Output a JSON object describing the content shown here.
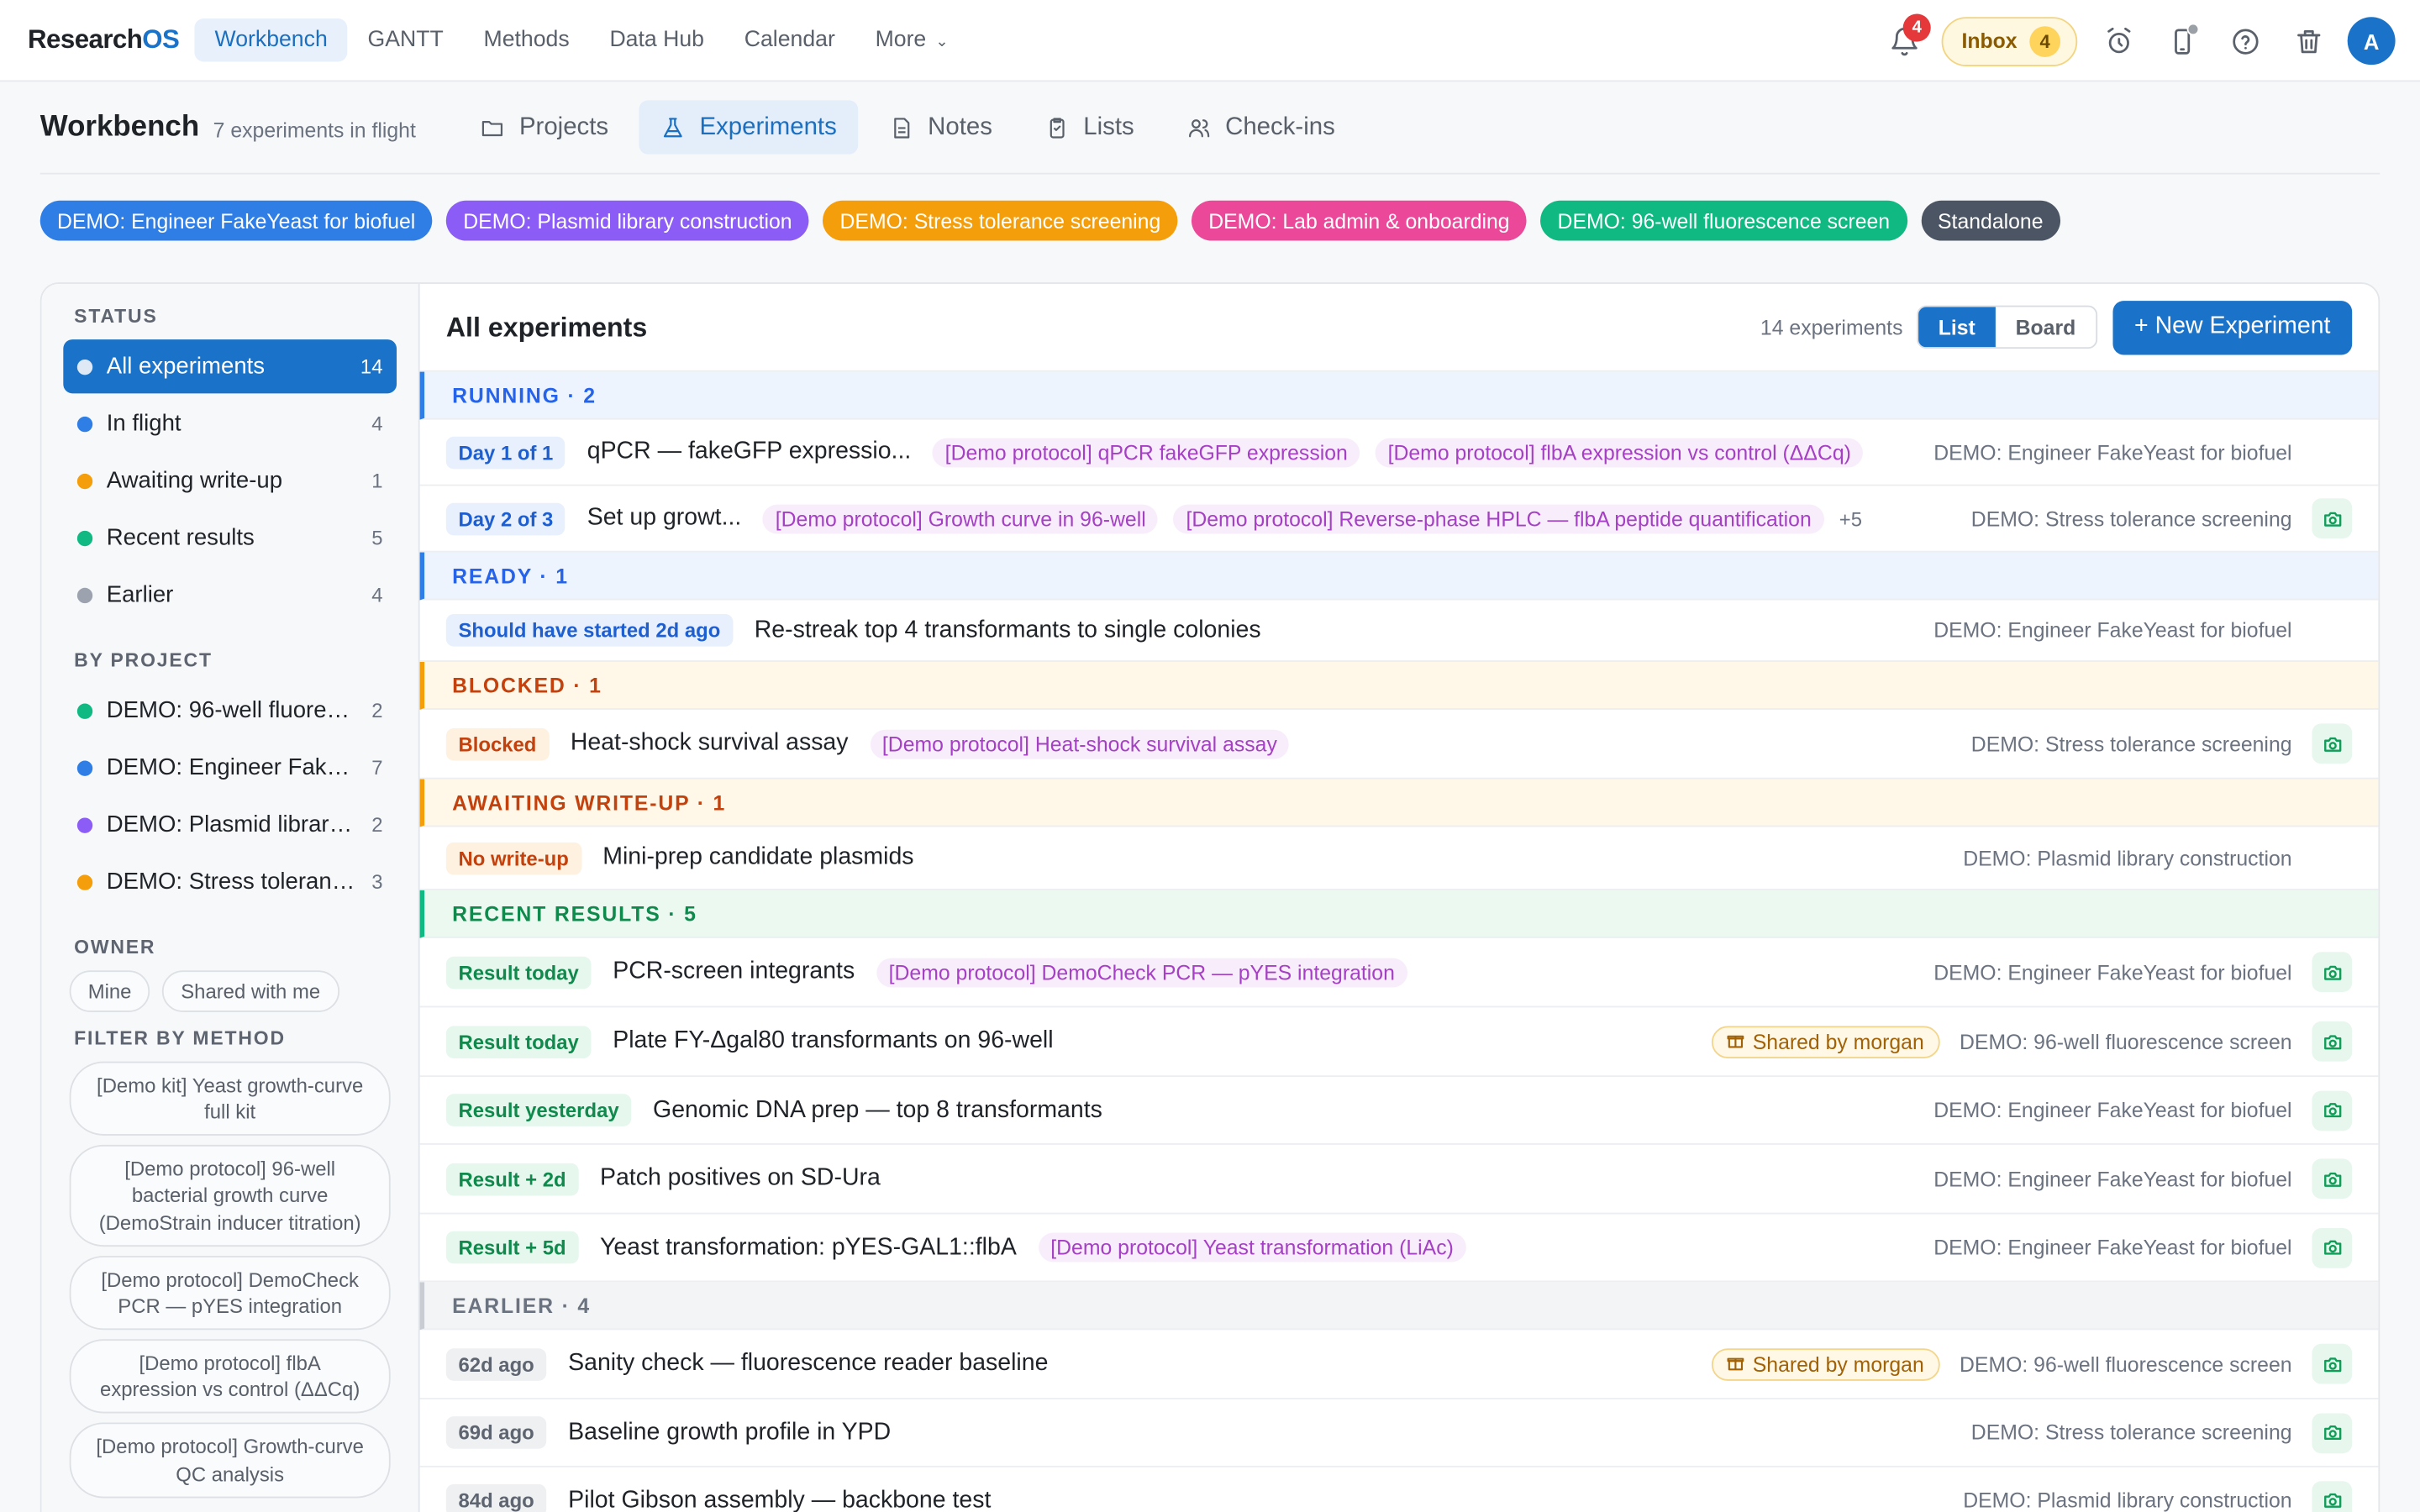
{
  "brand": {
    "name": "Research",
    "accent": "OS"
  },
  "nav": {
    "links": [
      "Workbench",
      "GANTT",
      "Methods",
      "Data Hub",
      "Calendar",
      "More"
    ],
    "notifications_count": "4",
    "inbox_label": "Inbox",
    "inbox_count": "4",
    "avatar_initial": "A"
  },
  "page": {
    "title": "Workbench",
    "subtitle": "7 experiments in flight",
    "tabs": [
      "Projects",
      "Experiments",
      "Notes",
      "Lists",
      "Check-ins"
    ]
  },
  "project_chips": [
    {
      "label": "DEMO: Engineer FakeYeast for biofuel",
      "color": "#2f7ee6"
    },
    {
      "label": "DEMO: Plasmid library construction",
      "color": "#8b5cf6"
    },
    {
      "label": "DEMO: Stress tolerance screening",
      "color": "#f59e0b"
    },
    {
      "label": "DEMO: Lab admin & onboarding",
      "color": "#ec4899"
    },
    {
      "label": "DEMO: 96-well fluorescence screen",
      "color": "#10b981"
    },
    {
      "label": "Standalone",
      "color": "#4b5563"
    }
  ],
  "sidebar": {
    "status_heading": "STATUS",
    "status": [
      {
        "label": "All experiments",
        "count": "14",
        "color": "#dfe9f5"
      },
      {
        "label": "In flight",
        "count": "4",
        "color": "#2f7ee6"
      },
      {
        "label": "Awaiting write-up",
        "count": "1",
        "color": "#f59e0b"
      },
      {
        "label": "Recent results",
        "count": "5",
        "color": "#10b981"
      },
      {
        "label": "Earlier",
        "count": "4",
        "color": "#9ca3af"
      }
    ],
    "project_heading": "BY PROJECT",
    "projects": [
      {
        "label": "DEMO: 96-well fluorescence screen",
        "count": "2",
        "color": "#10b981"
      },
      {
        "label": "DEMO: Engineer FakeYeast for biofuel",
        "count": "7",
        "color": "#2f7ee6"
      },
      {
        "label": "DEMO: Plasmid library construction",
        "count": "2",
        "color": "#8b5cf6"
      },
      {
        "label": "DEMO: Stress tolerance screening",
        "count": "3",
        "color": "#f59e0b"
      }
    ],
    "owner_heading": "OWNER",
    "owner": [
      "Mine",
      "Shared with me"
    ],
    "method_heading": "FILTER BY METHOD",
    "methods": [
      "[Demo kit] Yeast growth-curve full kit",
      "[Demo protocol] 96-well bacterial growth curve (DemoStrain inducer titration)",
      "[Demo protocol] DemoCheck PCR — pYES integration",
      "[Demo protocol] flbA expression vs control (ΔΔCq)",
      "[Demo protocol] Growth-curve QC analysis"
    ]
  },
  "content": {
    "title": "All experiments",
    "count_label": "14 experiments",
    "view_list": "List",
    "view_board": "Board",
    "new_button": "+ New Experiment"
  },
  "groups": [
    {
      "label": "RUNNING · 2",
      "color": "#2563eb",
      "bg": "#eef4fd",
      "border": "#2f7ee6"
    },
    {
      "label": "READY · 1",
      "color": "#2563eb",
      "bg": "#eef4fd",
      "border": "#2f7ee6"
    },
    {
      "label": "BLOCKED · 1",
      "color": "#c2410c",
      "bg": "#fff8e8",
      "border": "#f59e0b"
    },
    {
      "label": "AWAITING WRITE-UP · 1",
      "color": "#c2410c",
      "bg": "#fff8e8",
      "border": "#f59e0b"
    },
    {
      "label": "RECENT RESULTS · 5",
      "color": "#0f8a4c",
      "bg": "#ebf9f1",
      "border": "#10b981"
    },
    {
      "label": "EARLIER · 4",
      "color": "#6b7280",
      "bg": "#f3f4f6",
      "border": "#c9cdd3"
    }
  ],
  "rows": [
    {
      "tag": "Day 1 of 1",
      "title": "qPCR — fakeGFP expressio...",
      "protocols": [
        "[Demo protocol] qPCR fakeGFP expression",
        "[Demo protocol] flbA expression vs control (ΔΔCq)"
      ],
      "more": "",
      "shared": "",
      "project": "DEMO: Engineer FakeYeast for biofuel",
      "camera": false
    },
    {
      "tag": "Day 2 of 3",
      "title": "Set up growt...",
      "protocols": [
        "[Demo protocol] Growth curve in 96-well",
        "[Demo protocol] Reverse-phase HPLC — flbA peptide quantification"
      ],
      "more": "+5",
      "shared": "",
      "project": "DEMO: Stress tolerance screening",
      "camera": true
    },
    {
      "tag": "Should have started 2d ago",
      "title": "Re-streak top 4 transformants to single colonies",
      "protocols": [],
      "more": "",
      "shared": "",
      "project": "DEMO: Engineer FakeYeast for biofuel",
      "camera": false
    },
    {
      "tag": "Blocked",
      "title": "Heat-shock survival assay",
      "protocols": [
        "[Demo protocol] Heat-shock survival assay"
      ],
      "more": "",
      "shared": "",
      "project": "DEMO: Stress tolerance screening",
      "camera": true
    },
    {
      "tag": "No write-up",
      "title": "Mini-prep candidate plasmids",
      "protocols": [],
      "more": "",
      "shared": "",
      "project": "DEMO: Plasmid library construction",
      "camera": false
    },
    {
      "tag": "Result today",
      "title": "PCR-screen integrants",
      "protocols": [
        "[Demo protocol] DemoCheck PCR — pYES integration"
      ],
      "more": "",
      "shared": "",
      "project": "DEMO: Engineer FakeYeast for biofuel",
      "camera": true
    },
    {
      "tag": "Result today",
      "title": "Plate FY-Δgal80 transformants on 96-well",
      "protocols": [],
      "more": "",
      "shared": "Shared by morgan",
      "project": "DEMO: 96-well fluorescence screen",
      "camera": true
    },
    {
      "tag": "Result yesterday",
      "title": "Genomic DNA prep — top 8 transformants",
      "protocols": [],
      "more": "",
      "shared": "",
      "project": "DEMO: Engineer FakeYeast for biofuel",
      "camera": true
    },
    {
      "tag": "Result + 2d",
      "title": "Patch positives on SD-Ura",
      "protocols": [],
      "more": "",
      "shared": "",
      "project": "DEMO: Engineer FakeYeast for biofuel",
      "camera": true
    },
    {
      "tag": "Result + 5d",
      "title": "Yeast transformation: pYES-GAL1::flbA",
      "protocols": [
        "[Demo protocol] Yeast transformation (LiAc)"
      ],
      "more": "",
      "shared": "",
      "project": "DEMO: Engineer FakeYeast for biofuel",
      "camera": true
    },
    {
      "tag": "62d ago",
      "title": "Sanity check — fluorescence reader baseline",
      "protocols": [],
      "more": "",
      "shared": "Shared by morgan",
      "project": "DEMO: 96-well fluorescence screen",
      "camera": true
    },
    {
      "tag": "69d ago",
      "title": "Baseline growth profile in YPD",
      "protocols": [],
      "more": "",
      "shared": "",
      "project": "DEMO: Stress tolerance screening",
      "camera": true
    },
    {
      "tag": "84d ago",
      "title": "Pilot Gibson assembly — backbone test",
      "protocols": [],
      "more": "",
      "shared": "",
      "project": "DEMO: Plasmid library construction",
      "camera": true
    }
  ]
}
